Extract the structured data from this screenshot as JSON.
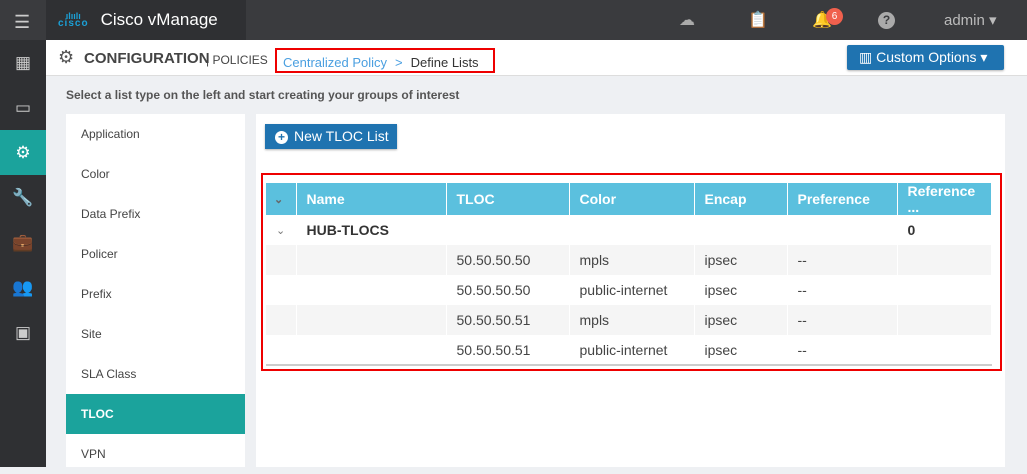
{
  "app": {
    "brand": "cisco",
    "title": "Cisco vManage",
    "notifications": "6",
    "user": "admin"
  },
  "sidebar": [
    "dashboard",
    "monitor",
    "configuration",
    "tools",
    "maintenance",
    "administration",
    "analytics"
  ],
  "header": {
    "title": "CONFIGURATION",
    "section": "POLICIES",
    "breadcrumb": [
      "Centralized Policy",
      ">",
      "Define Lists"
    ],
    "custom_options": "Custom Options"
  },
  "subtitle": "Select a list type on the left and start creating your groups of interest",
  "list_types": [
    "Application",
    "Color",
    "Data Prefix",
    "Policer",
    "Prefix",
    "Site",
    "SLA Class",
    "TLOC",
    "VPN"
  ],
  "new_button": "New TLOC List",
  "table": {
    "columns": [
      "Name",
      "TLOC",
      "Color",
      "Encap",
      "Preference",
      "Reference ..."
    ],
    "group": {
      "name": "HUB-TLOCS",
      "reference": "0"
    },
    "rows": [
      [
        "50.50.50.50",
        "mpls",
        "ipsec",
        "--"
      ],
      [
        "50.50.50.50",
        "public-internet",
        "ipsec",
        "--"
      ],
      [
        "50.50.50.51",
        "mpls",
        "ipsec",
        "--"
      ],
      [
        "50.50.50.51",
        "public-internet",
        "ipsec",
        "--"
      ]
    ]
  }
}
